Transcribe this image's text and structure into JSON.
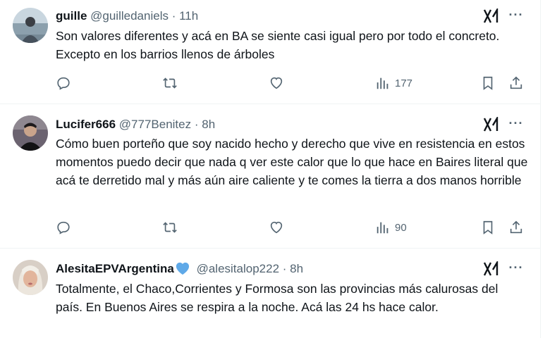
{
  "tweets": [
    {
      "name": "guille",
      "handle": "@guilledaniels",
      "separator": "·",
      "time": "11h",
      "verified": false,
      "text": "Son valores diferentes y acá en BA se siente casi igual pero por todo el concreto. Excepto en los barrios llenos de árboles",
      "views": "177"
    },
    {
      "name": "Lucifer666",
      "handle": "@777Benitez",
      "separator": "·",
      "time": "8h",
      "verified": false,
      "text": "Cómo buen porteño que soy nacido hecho y derecho que vive en resistencia en estos momentos puedo decir que nada q ver este calor que lo que hace en Baires literal que acá te derretido mal y más aún aire caliente y te comes la tierra a dos manos horrible",
      "views": "90"
    },
    {
      "name": "AlesitaEPVArgentina",
      "handle": "@alesitalop222",
      "separator": "·",
      "time": "8h",
      "verified": true,
      "text": "Totalmente, el Chaco,Corrientes y Formosa son las provincias más calurosas del país. En Buenos Aires se respira a la noche. Acá las 24 hs hace calor.",
      "views": ""
    }
  ],
  "icons": {
    "grok": "grok-icon",
    "more": "more-icon",
    "reply": "reply-icon",
    "retweet": "retweet-icon",
    "like": "like-icon",
    "views": "views-icon",
    "bookmark": "bookmark-icon",
    "share": "share-icon"
  },
  "colors": {
    "text_primary": "#0f1419",
    "text_secondary": "#536471",
    "divider": "#eff3f4",
    "verified_heart": "#5fa9e8"
  }
}
